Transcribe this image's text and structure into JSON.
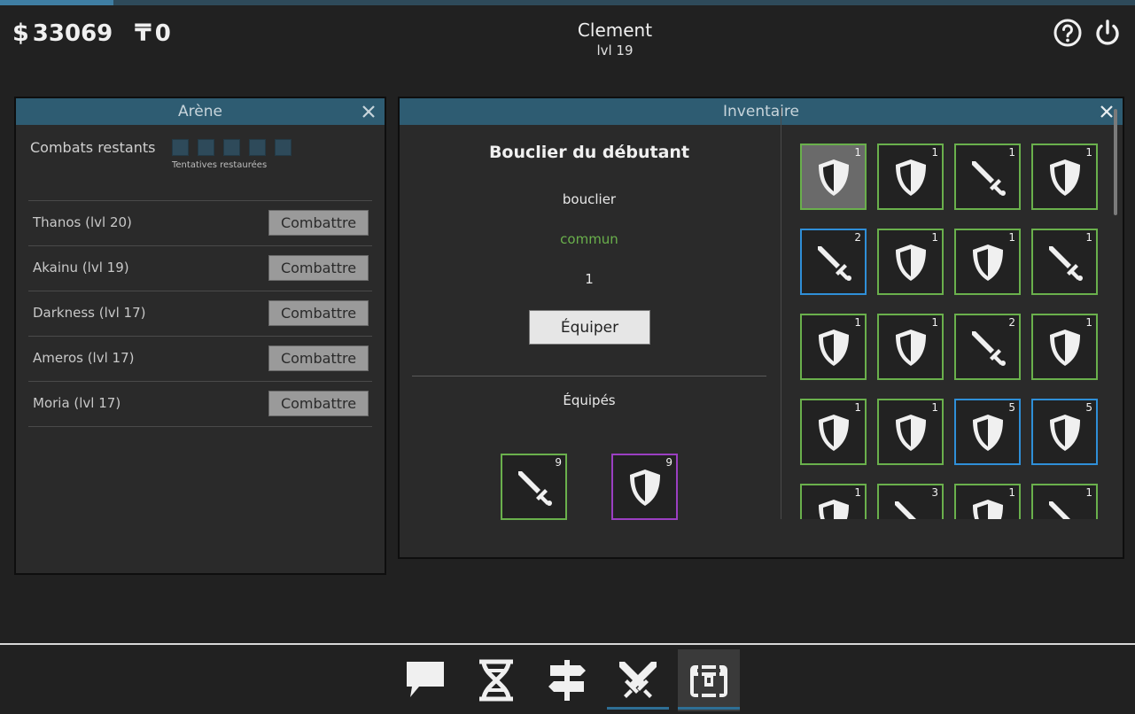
{
  "hud": {
    "money": "33069",
    "money_symbol": "$",
    "tokens": "0",
    "tokens_symbol": "₸",
    "player_name": "Clement",
    "player_level": "lvl 19",
    "progress_fraction": 0.1
  },
  "arena": {
    "title": "Arène",
    "remaining_label": "Combats restants",
    "remaining_slots": 5,
    "restored_label": "Tentatives restaurées",
    "fight_label": "Combattre",
    "opponents": [
      {
        "name": "Thanos (lvl 20)"
      },
      {
        "name": "Akainu (lvl 19)"
      },
      {
        "name": "Darkness (lvl 17)"
      },
      {
        "name": "Ameros (lvl 17)"
      },
      {
        "name": "Moria (lvl 17)"
      }
    ]
  },
  "inventory": {
    "title": "Inventaire",
    "selected": {
      "name": "Bouclier du débutant",
      "type": "bouclier",
      "rarity": "commun",
      "rarity_color": "#6ab04c",
      "quantity": "1",
      "equip_label": "Équiper"
    },
    "equipped_label": "Équipés",
    "equipped": [
      {
        "icon": "sword",
        "count": "9",
        "rarity": "common"
      },
      {
        "icon": "shield",
        "count": "9",
        "rarity": "epic"
      }
    ],
    "items": [
      {
        "icon": "shield",
        "count": "1",
        "rarity": "common",
        "selected": true
      },
      {
        "icon": "shield",
        "count": "1",
        "rarity": "common"
      },
      {
        "icon": "sword",
        "count": "1",
        "rarity": "common"
      },
      {
        "icon": "shield",
        "count": "1",
        "rarity": "common"
      },
      {
        "icon": "sword",
        "count": "2",
        "rarity": "rare"
      },
      {
        "icon": "shield",
        "count": "1",
        "rarity": "common"
      },
      {
        "icon": "shield",
        "count": "1",
        "rarity": "common"
      },
      {
        "icon": "sword",
        "count": "1",
        "rarity": "common"
      },
      {
        "icon": "shield",
        "count": "1",
        "rarity": "common"
      },
      {
        "icon": "shield",
        "count": "1",
        "rarity": "common"
      },
      {
        "icon": "sword",
        "count": "2",
        "rarity": "common"
      },
      {
        "icon": "shield",
        "count": "1",
        "rarity": "common"
      },
      {
        "icon": "shield",
        "count": "1",
        "rarity": "common"
      },
      {
        "icon": "shield",
        "count": "1",
        "rarity": "common"
      },
      {
        "icon": "shield",
        "count": "5",
        "rarity": "rare"
      },
      {
        "icon": "shield",
        "count": "5",
        "rarity": "rare"
      },
      {
        "icon": "shield",
        "count": "1",
        "rarity": "common"
      },
      {
        "icon": "sword",
        "count": "3",
        "rarity": "common"
      },
      {
        "icon": "shield",
        "count": "1",
        "rarity": "common"
      },
      {
        "icon": "sword",
        "count": "1",
        "rarity": "common"
      }
    ]
  },
  "nav": [
    {
      "icon": "chat-icon",
      "active": false,
      "underline": false
    },
    {
      "icon": "dna-icon",
      "active": false,
      "underline": false
    },
    {
      "icon": "signpost-icon",
      "active": false,
      "underline": false
    },
    {
      "icon": "crossed-swords-icon",
      "active": false,
      "underline": true
    },
    {
      "icon": "treasure-chest-icon",
      "active": true,
      "underline": true
    }
  ]
}
